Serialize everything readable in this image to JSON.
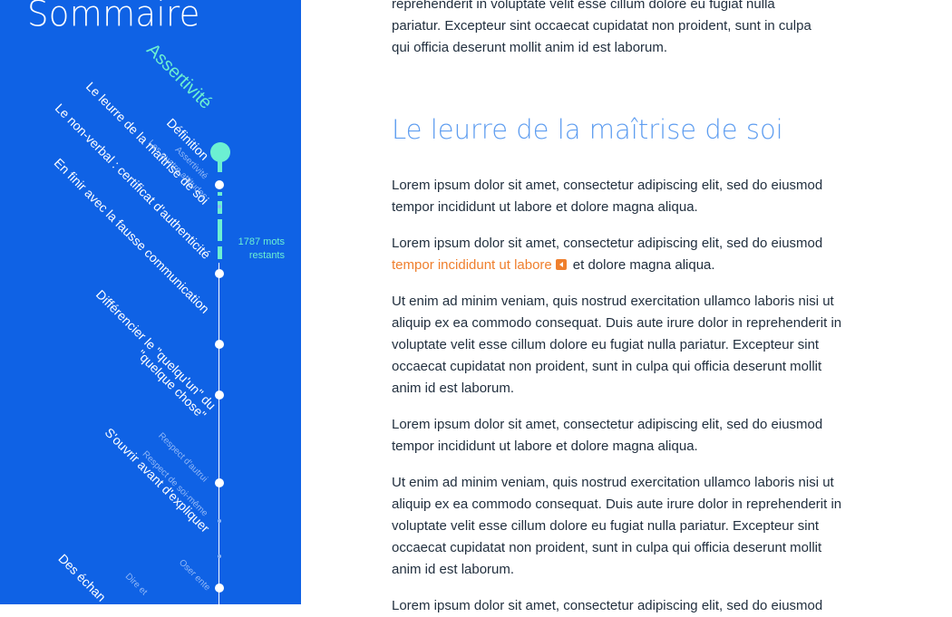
{
  "sidebar": {
    "title": "Sommaire",
    "words_remaining": "1787 mots restants",
    "chapter": "Assertivité",
    "sections": [
      {
        "label": "Définition"
      },
      {
        "label": "Le leurre de la maîtrise de soi"
      },
      {
        "label": "Le non-verbal : certificat d'authenticité"
      },
      {
        "label": "En finir avec la fausse communication"
      },
      {
        "label": "Différencier le \"quelqu'un\" du \"quelque chose\""
      },
      {
        "label": "S'ouvrir avant d'expliquer"
      },
      {
        "label": "Des échan"
      }
    ],
    "subsections": [
      {
        "label": "Assertivité"
      },
      {
        "label": "Les quatre attitudes"
      },
      {
        "label": "Respect d'autrui"
      },
      {
        "label": "Respect de soi-même"
      },
      {
        "label": "Oser ente"
      },
      {
        "label": "Dire et"
      }
    ]
  },
  "article": {
    "top_paragraph_lines": [
      "reprehenderit in voluptate velit esse cillum dolore eu fugiat nulla",
      "pariatur. Excepteur sint occaecat cupidatat non proident, sunt in culpa",
      "qui officia deserunt mollit anim id est laborum."
    ],
    "heading": "Le leurre de la maîtrise de soi",
    "p1": "Lorem ipsum dolor sit amet, consectetur adipiscing elit, sed do eiusmod tempor incididunt ut labore et dolore magna aliqua.",
    "p2_start": "Lorem ipsum dolor sit amet, consectetur adipiscing elit, sed do eiusmod",
    "p2_link": "tempor incididunt ut labore",
    "p2_end": "et dolore magna aliqua.",
    "p3": "Ut enim ad minim veniam, quis nostrud exercitation ullamco laboris nisi ut aliquip ex ea commodo consequat. Duis aute irure dolor in reprehenderit in voluptate velit esse cillum dolore eu fugiat nulla pariatur. Excepteur sint occaecat cupidatat non proident, sunt in culpa qui officia deserunt mollit anim id est laborum.",
    "p4": "Lorem ipsum dolor sit amet, consectetur adipiscing elit, sed do eiusmod tempor incididunt ut labore et dolore magna aliqua.",
    "p5": "Ut enim ad minim veniam, quis nostrud exercitation ullamco laboris nisi ut aliquip ex ea commodo consequat. Duis aute irure dolor in reprehenderit in voluptate velit esse cillum dolore eu fugiat nulla pariatur. Excepteur sint occaecat cupidatat non proident, sunt in culpa qui officia deserunt mollit anim id est laborum.",
    "p6": "Lorem ipsum dolor sit amet, consectetur adipiscing elit, sed do eiusmod"
  },
  "colors": {
    "sidebar_bg": "#0f62e5",
    "accent_mint": "#6cf0d2",
    "heading_blue": "#5e9df0",
    "link_orange": "#ef7f2d",
    "text_dark": "#22303f"
  },
  "icons": [
    "comment-icon"
  ]
}
